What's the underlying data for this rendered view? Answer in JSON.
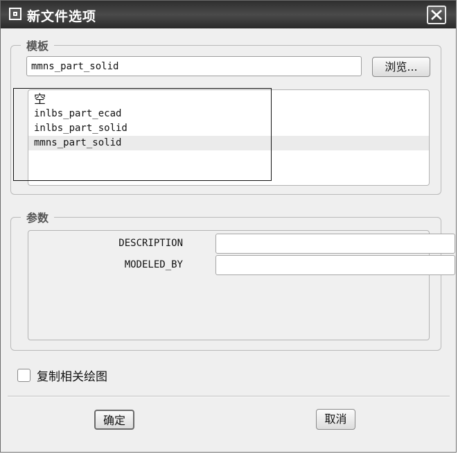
{
  "window": {
    "title": "新文件选项",
    "icon": "dialog-window-icon",
    "close_icon": "close-icon"
  },
  "template_group": {
    "legend": "模板",
    "selected_value": "mmns_part_solid",
    "browse_label": "浏览...",
    "items": [
      {
        "label": "空"
      },
      {
        "label": "inlbs_part_ecad"
      },
      {
        "label": "inlbs_part_solid"
      },
      {
        "label": "mmns_part_solid"
      }
    ]
  },
  "params_group": {
    "legend": "参数",
    "fields": [
      {
        "label": "DESCRIPTION",
        "value": ""
      },
      {
        "label": "MODELED_BY",
        "value": ""
      }
    ]
  },
  "copy_drawings": {
    "label": "复制相关绘图",
    "checked": false
  },
  "footer": {
    "ok_label": "确定",
    "cancel_label": "取消"
  }
}
